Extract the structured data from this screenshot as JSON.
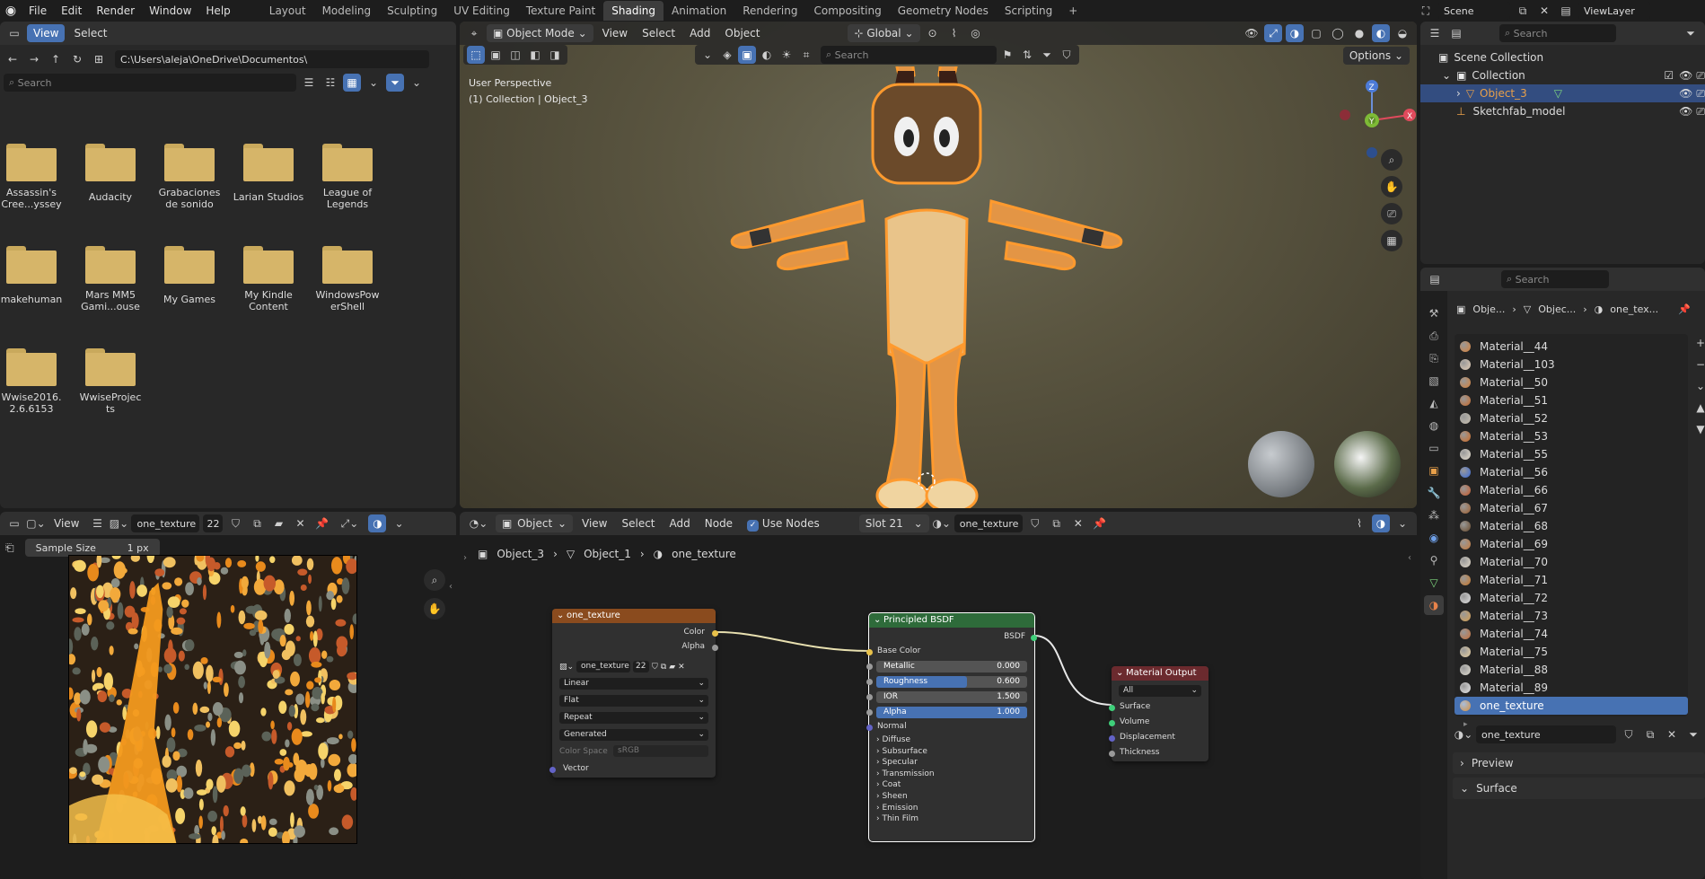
{
  "topbar": {
    "menus": [
      "File",
      "Edit",
      "Render",
      "Window",
      "Help"
    ],
    "workspaces": [
      "Layout",
      "Modeling",
      "Sculpting",
      "UV Editing",
      "Texture Paint",
      "Shading",
      "Animation",
      "Rendering",
      "Compositing",
      "Geometry Nodes",
      "Scripting"
    ],
    "active_workspace": "Shading",
    "scene": "Scene",
    "view_layer": "ViewLayer"
  },
  "filebrowser": {
    "view": "View",
    "select": "Select",
    "path": "C:\\Users\\aleja\\OneDrive\\Documentos\\",
    "search_placeholder": "Search",
    "folders": [
      "Assassin's Cree...yssey",
      "Audacity",
      "Grabaciones de sonido",
      "Larian Studios",
      "League of Legends",
      "makehuman",
      "Mars MM5 Gami...ouse",
      "My Games",
      "My Kindle Content",
      "WindowsPowerShell",
      "Wwise2016.2.6.6153",
      "WwiseProjects"
    ]
  },
  "viewport": {
    "mode": "Object Mode",
    "menus": [
      "View",
      "Select",
      "Add",
      "Object"
    ],
    "orientation": "Global",
    "search_placeholder": "Search",
    "options": "Options",
    "overlay_title": "User Perspective",
    "overlay_sub": "(1) Collection | Object_3",
    "gizmo": {
      "x": "X",
      "y": "Y",
      "z": "Z"
    }
  },
  "image_editor": {
    "view": "View",
    "image_name": "one_texture",
    "users": "22",
    "sample_label": "Sample Size",
    "sample_value": "1 px"
  },
  "node_editor": {
    "type": "Object",
    "menus": [
      "View",
      "Select",
      "Add",
      "Node"
    ],
    "use_nodes": "Use Nodes",
    "slot": "Slot 21",
    "material": "one_texture",
    "breadcrumb": [
      "Object_3",
      "Object_1",
      "one_texture"
    ],
    "tex_node": {
      "title": "one_texture",
      "out_color": "Color",
      "out_alpha": "Alpha",
      "image": "one_texture",
      "users": "22",
      "interp": "Linear",
      "proj": "Flat",
      "ext": "Repeat",
      "source": "Generated",
      "cs_label": "Color Space",
      "cs_value": "sRGB",
      "in_vector": "Vector"
    },
    "bsdf_node": {
      "title": "Principled BSDF",
      "out": "BSDF",
      "base_color": "Base Color",
      "metallic": {
        "label": "Metallic",
        "value": "0.000",
        "fill": 0
      },
      "roughness": {
        "label": "Roughness",
        "value": "0.600",
        "fill": 0.6
      },
      "ior": {
        "label": "IOR",
        "value": "1.500",
        "fill": 0
      },
      "alpha": {
        "label": "Alpha",
        "value": "1.000",
        "fill": 1
      },
      "normal": "Normal",
      "panels": [
        "Diffuse",
        "Subsurface",
        "Specular",
        "Transmission",
        "Coat",
        "Sheen",
        "Emission",
        "Thin Film"
      ]
    },
    "output_node": {
      "title": "Material Output",
      "target": "All",
      "inputs": [
        "Surface",
        "Volume",
        "Displacement",
        "Thickness"
      ]
    }
  },
  "outliner": {
    "search_placeholder": "Search",
    "items": [
      {
        "label": "Scene Collection",
        "indent": 0
      },
      {
        "label": "Collection",
        "indent": 1
      },
      {
        "label": "Object_3",
        "indent": 2,
        "selected": true
      },
      {
        "label": "Sketchfab_model",
        "indent": 2
      }
    ]
  },
  "properties": {
    "search_placeholder": "Search",
    "breadcrumb": [
      "Obje...",
      "Objec...",
      "one_tex..."
    ],
    "materials": [
      "Material__44",
      "Material__103",
      "Material__50",
      "Material__51",
      "Material__52",
      "Material__53",
      "Material__55",
      "Material__56",
      "Material__66",
      "Material__67",
      "Material__68",
      "Material__69",
      "Material__70",
      "Material__71",
      "Material__72",
      "Material__73",
      "Material__74",
      "Material__75",
      "Material__88",
      "Material__89",
      "one_texture"
    ],
    "selected_material": "one_texture",
    "material_field": "one_texture",
    "panels": [
      "Preview",
      "Surface"
    ]
  }
}
